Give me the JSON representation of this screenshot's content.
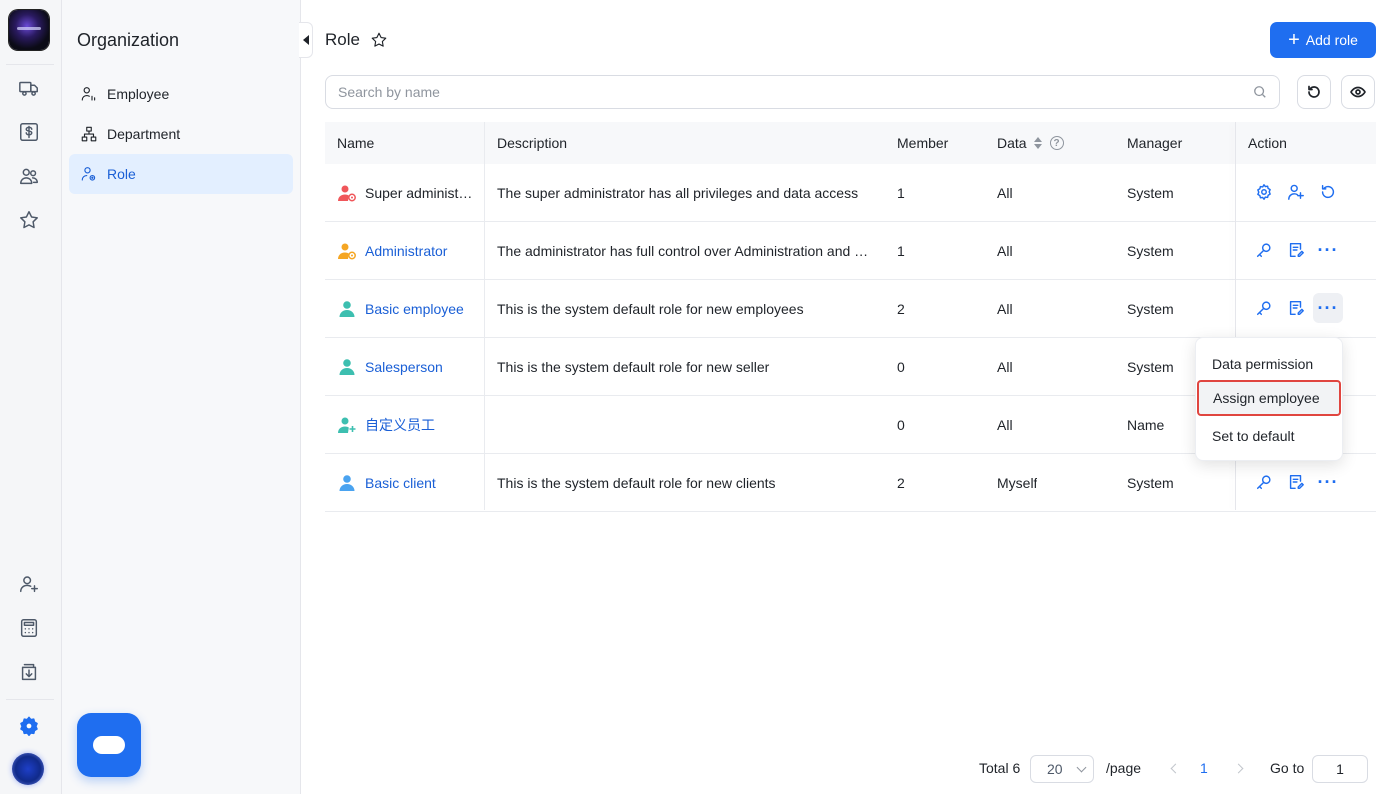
{
  "sidebar": {
    "title": "Organization",
    "items": [
      {
        "label": "Employee"
      },
      {
        "label": "Department"
      },
      {
        "label": "Role"
      }
    ]
  },
  "header": {
    "title": "Role",
    "add_label": "Add role"
  },
  "search": {
    "placeholder": "Search by name",
    "value": ""
  },
  "table": {
    "columns": {
      "name": "Name",
      "description": "Description",
      "member": "Member",
      "data": "Data",
      "manager": "Manager",
      "action": "Action"
    },
    "rows": [
      {
        "name": "Super administ…",
        "description": "The super administrator has all privileges and data access",
        "member": "1",
        "data": "All",
        "manager": "System"
      },
      {
        "name": "Administrator",
        "description": "The administrator has full control over Administration and …",
        "member": "1",
        "data": "All",
        "manager": "System"
      },
      {
        "name": "Basic employee",
        "description": "This is the system default role for new employees",
        "member": "2",
        "data": "All",
        "manager": "System"
      },
      {
        "name": "Salesperson",
        "description": "This is the system default role for new seller",
        "member": "0",
        "data": "All",
        "manager": "System"
      },
      {
        "name": "自定义员工",
        "description": "",
        "member": "0",
        "data": "All",
        "manager": "Name"
      },
      {
        "name": "Basic client",
        "description": "This is the system default role for new clients",
        "member": "2",
        "data": "Myself",
        "manager": "System"
      }
    ]
  },
  "dropdown": {
    "items": [
      {
        "label": "Data permission"
      },
      {
        "label": "Assign employee"
      },
      {
        "label": "Set to default"
      }
    ]
  },
  "pagination": {
    "total_label": "Total 6",
    "page_size": "20",
    "per_page_label": "/page",
    "current_page": "1",
    "goto_label": "Go to",
    "goto_value": "1"
  },
  "colors": {
    "accent": "#1f6ef0",
    "highlight_border": "#e0453f",
    "super_admin_icon": "#f0565a",
    "admin_icon": "#f5a623",
    "employee_icon": "#3dbfb0",
    "client_icon": "#4aa3f0"
  }
}
